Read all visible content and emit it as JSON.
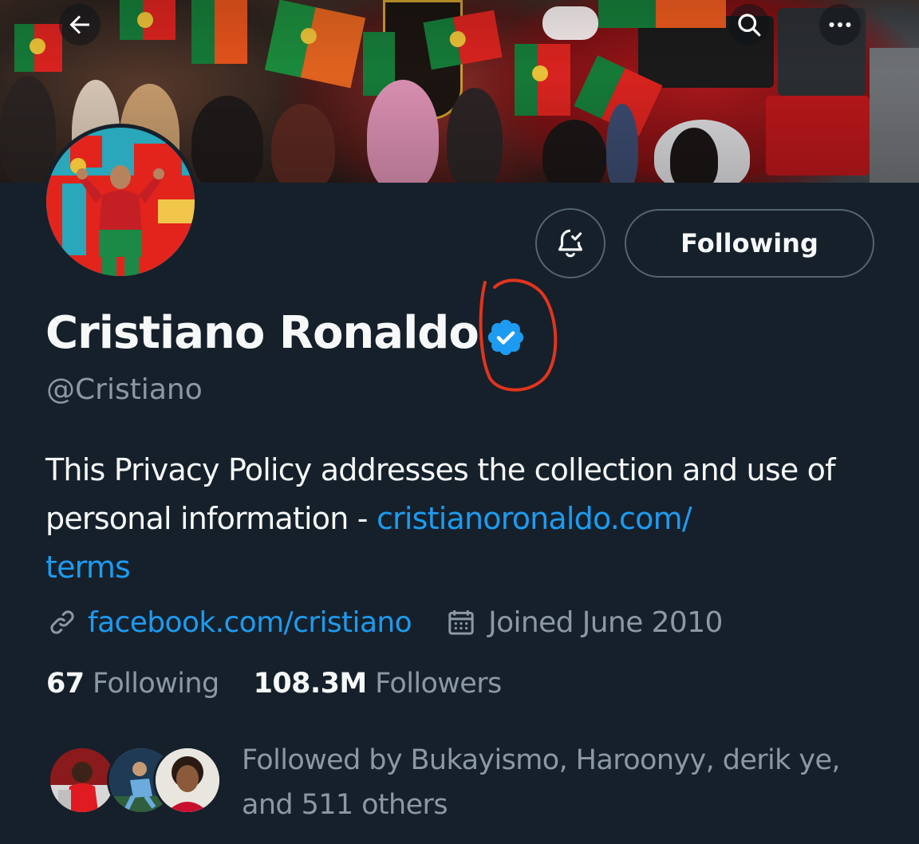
{
  "banner": {
    "alt": "Cover photo"
  },
  "profile": {
    "display_name": "Cristiano Ronaldo",
    "handle": "@Cristiano",
    "verified": true,
    "bio_text": "This Privacy Policy addresses the collection and use of personal information - ",
    "bio_link": "cristianoronaldo.com/terms",
    "bio_link_line1": "cristianoronaldo.com/",
    "bio_link_line2": "terms",
    "website": "facebook.com/cristiano",
    "joined": "Joined June 2010"
  },
  "actions": {
    "following_label": "Following"
  },
  "stats": {
    "following_count": "67",
    "following_label": "Following",
    "followers_count": "108.3M",
    "followers_label": "Followers"
  },
  "followed_by": {
    "line1": "Followed by Bukayismo, Haroonyy, derik ye,",
    "line2": "and 511 others"
  },
  "icons": {
    "back": "arrow-left-icon",
    "search": "search-icon",
    "more": "more-dots-icon",
    "notify": "bell-check-icon",
    "verified": "verified-badge-icon",
    "link": "link-icon",
    "calendar": "calendar-icon"
  },
  "colors": {
    "background": "#15202b",
    "accent": "#1d9bf0",
    "secondary_text": "#8b98a5",
    "annotation": "#e2341d"
  }
}
